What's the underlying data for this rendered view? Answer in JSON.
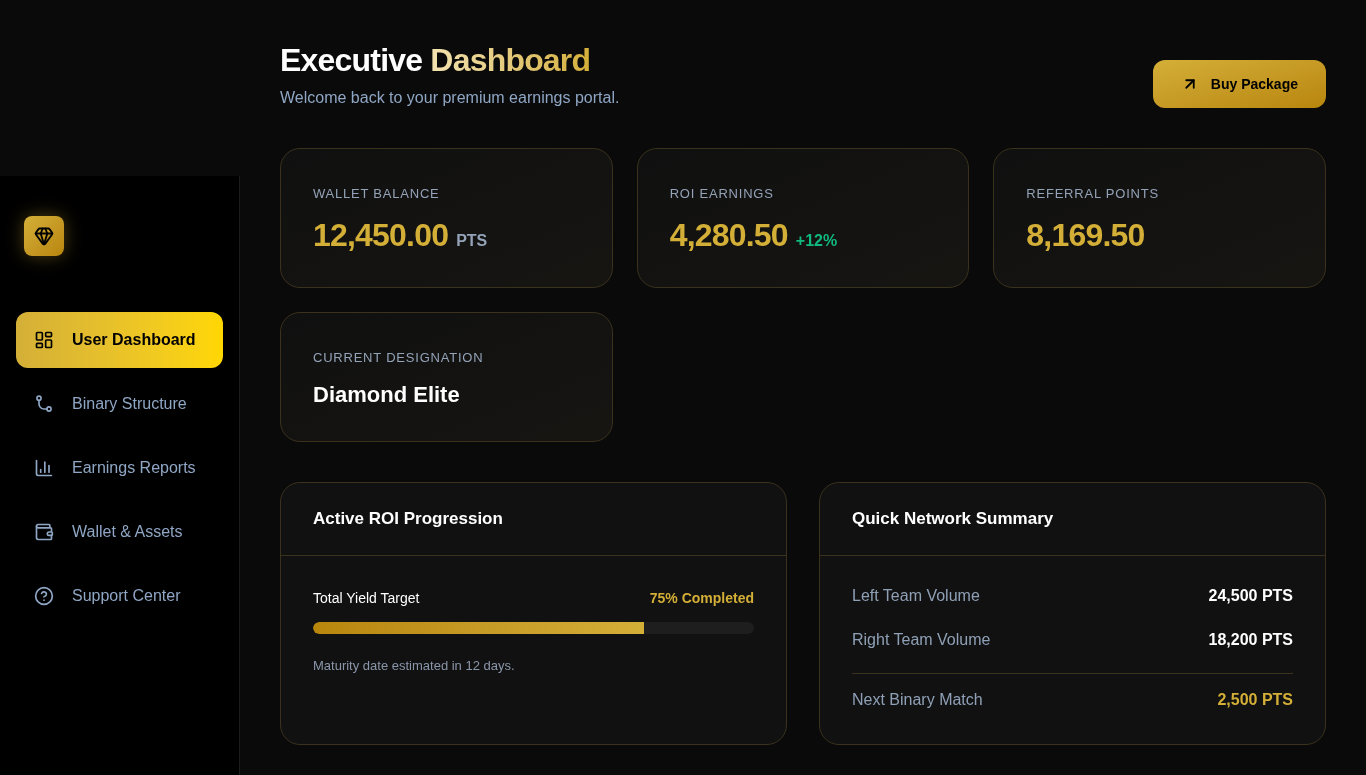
{
  "sidebar": {
    "items": [
      {
        "label": "User Dashboard",
        "selected": true
      },
      {
        "label": "Binary Structure",
        "selected": false
      },
      {
        "label": "Earnings Reports",
        "selected": false
      },
      {
        "label": "Wallet & Assets",
        "selected": false
      },
      {
        "label": "Support Center",
        "selected": false
      }
    ]
  },
  "header": {
    "title": {
      "lead": "Executive",
      "accent": "Dashboard"
    },
    "subtitle": "Welcome back to your premium earnings portal.",
    "action": {
      "label": "Buy Package"
    }
  },
  "stats": [
    {
      "kind": "amount",
      "label": "WALLET BALANCE",
      "value": "12,450.00",
      "suffix": "PTS"
    },
    {
      "kind": "amount",
      "label": "ROI EARNINGS",
      "value": "4,280.50",
      "change": "+12%"
    },
    {
      "kind": "amount",
      "label": "REFERRAL POINTS",
      "value": "8,169.50"
    },
    {
      "kind": "rank",
      "label": "CURRENT DESIGNATION",
      "value": "Diamond Elite"
    }
  ],
  "roi_progress": {
    "title": "Active ROI Progression",
    "label": "Total Yield Target",
    "reading": "75% Completed",
    "level": 0.75,
    "note": "Maturity date estimated in 12 days."
  },
  "network_summary": {
    "title": "Quick Network Summary",
    "rows": [
      {
        "kind": "volume",
        "label": "Left Team Volume",
        "value": "24,500 PTS"
      },
      {
        "kind": "volume",
        "label": "Right Team Volume",
        "value": "18,200 PTS"
      },
      {
        "kind": "total",
        "label": "Next Binary Match",
        "value": "2,500 PTS"
      }
    ]
  }
}
